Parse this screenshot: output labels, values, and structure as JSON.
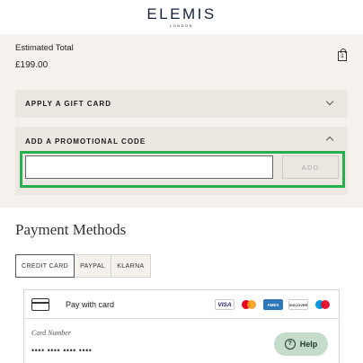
{
  "header": {
    "logo": "ELEMIS",
    "logo_sub": "LONDON"
  },
  "summary": {
    "label": "Estimated Total",
    "value": "£199.00",
    "bag_count": "1"
  },
  "gift_card": {
    "label": "APPLY A GIFT CARD"
  },
  "promo": {
    "label": "ADD A PROMOTIONAL CODE",
    "input_value": "",
    "add_label": "ADD"
  },
  "payment": {
    "title": "Payment Methods",
    "tabs": [
      "CREDIT CARD",
      "PAYPAL",
      "KLARNA"
    ],
    "active_tab": "CREDIT CARD",
    "pay_with_card": "Pay with card",
    "brands": [
      "VISA",
      "mastercard",
      "AMEX",
      "DISCOVER",
      "maestro"
    ],
    "card_number_label": "Card Number",
    "card_number_placeholder": "•••• •••• •••• ••••"
  },
  "help": {
    "label": "Help"
  },
  "colors": {
    "highlight": "#27ae4e",
    "panel": "#f5f1ec",
    "help_bg": "#c5dccb"
  }
}
